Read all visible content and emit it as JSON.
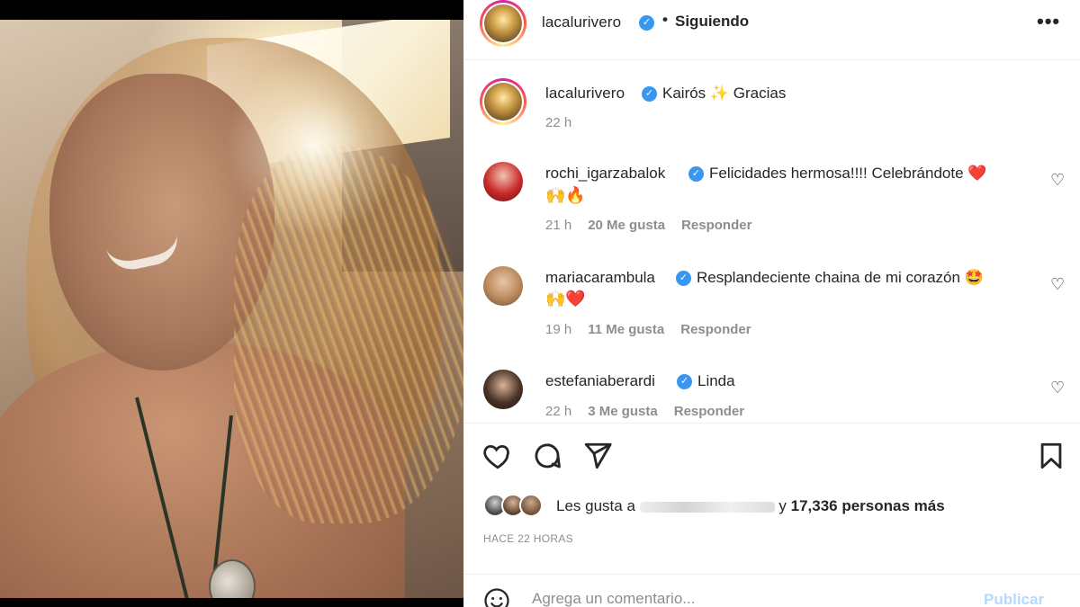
{
  "header": {
    "username": "lacalurivero",
    "separator": "•",
    "follow_status": "Siguiendo",
    "more_icon": "more-horizontal-icon",
    "more_glyph": "•••"
  },
  "caption": {
    "username": "lacalurivero",
    "text": "Kairós ✨ Gracias",
    "time": "22 h"
  },
  "comments": [
    {
      "username": "rochi_igarzabalok",
      "text": "Felicidades hermosa!!!! Celebrándote ❤️",
      "emoji_line": "🙌🔥",
      "time": "21 h",
      "likes": "20 Me gusta",
      "reply": "Responder"
    },
    {
      "username": "mariacarambula",
      "text": "Resplandeciente chaina de mi corazón 🤩",
      "emoji_line": "🙌❤️",
      "time": "19 h",
      "likes": "11 Me gusta",
      "reply": "Responder"
    },
    {
      "username": "estefaniaberardi",
      "text": "Linda",
      "emoji_line": "",
      "time": "22 h",
      "likes": "3 Me gusta",
      "reply": "Responder"
    }
  ],
  "likes": {
    "prefix": "Les gusta a",
    "suffix": "y",
    "count_text": "17,336 personas más"
  },
  "posted_ago": "HACE 22 HORAS",
  "compose": {
    "placeholder": "Agrega un comentario...",
    "post_label": "Publicar"
  },
  "icons": {
    "like": "heart-icon",
    "comment": "comment-icon",
    "share": "send-icon",
    "save": "bookmark-icon",
    "emoji": "emoji-icon"
  },
  "colors": {
    "verified": "#3897f0",
    "post_disabled": "#b3dbff",
    "meta_text": "#8e8e8e"
  }
}
